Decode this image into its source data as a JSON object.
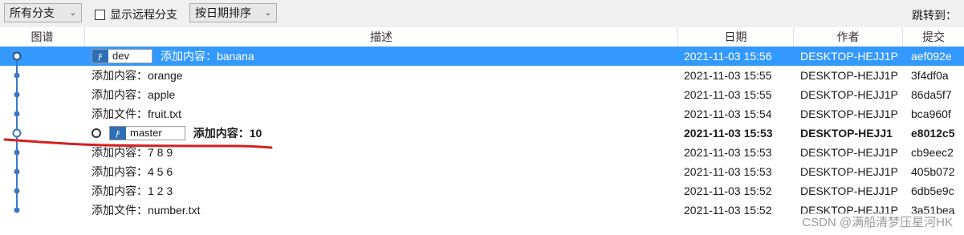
{
  "toolbar": {
    "branch_filter": "所有分支",
    "show_remote_label": "显示远程分支",
    "sort_label": "按日期排序",
    "jump_to_label": "跳转到："
  },
  "columns": {
    "graph": "图谱",
    "description": "描述",
    "date": "日期",
    "author": "作者",
    "commit": "提交"
  },
  "commits": [
    {
      "branch": "dev",
      "message": "添加内容：banana",
      "date": "2021-11-03 15:56",
      "author": "DESKTOP-HEJJ1P",
      "hash": "aef092e"
    },
    {
      "branch": "",
      "message": "添加内容：orange",
      "date": "2021-11-03 15:55",
      "author": "DESKTOP-HEJJ1P",
      "hash": "3f4df0a"
    },
    {
      "branch": "",
      "message": "添加内容：apple",
      "date": "2021-11-03 15:55",
      "author": "DESKTOP-HEJJ1P",
      "hash": "86da5f7"
    },
    {
      "branch": "",
      "message": "添加文件：fruit.txt",
      "date": "2021-11-03 15:54",
      "author": "DESKTOP-HEJJ1P",
      "hash": "bca960f"
    },
    {
      "branch": "master",
      "message": "添加内容：10",
      "date": "2021-11-03 15:53",
      "author": "DESKTOP-HEJJ1",
      "hash": "e8012c5"
    },
    {
      "branch": "",
      "message": "添加内容：7 8 9",
      "date": "2021-11-03 15:53",
      "author": "DESKTOP-HEJJ1P",
      "hash": "cb9eec2"
    },
    {
      "branch": "",
      "message": "添加内容：4 5 6",
      "date": "2021-11-03 15:53",
      "author": "DESKTOP-HEJJ1P",
      "hash": "405b072"
    },
    {
      "branch": "",
      "message": "添加内容：1 2 3",
      "date": "2021-11-03 15:52",
      "author": "DESKTOP-HEJJ1P",
      "hash": "6db5e9c"
    },
    {
      "branch": "",
      "message": "添加文件：number.txt",
      "date": "2021-11-03 15:52",
      "author": "DESKTOP-HEJJ1P",
      "hash": "3a51bea"
    }
  ],
  "watermark": "CSDN @满船清梦压星河HK",
  "colors": {
    "selection": "#3399ff",
    "graph_line": "#3a78c4",
    "branch_icon": "#2f6fb5",
    "annotation": "#d42020"
  }
}
